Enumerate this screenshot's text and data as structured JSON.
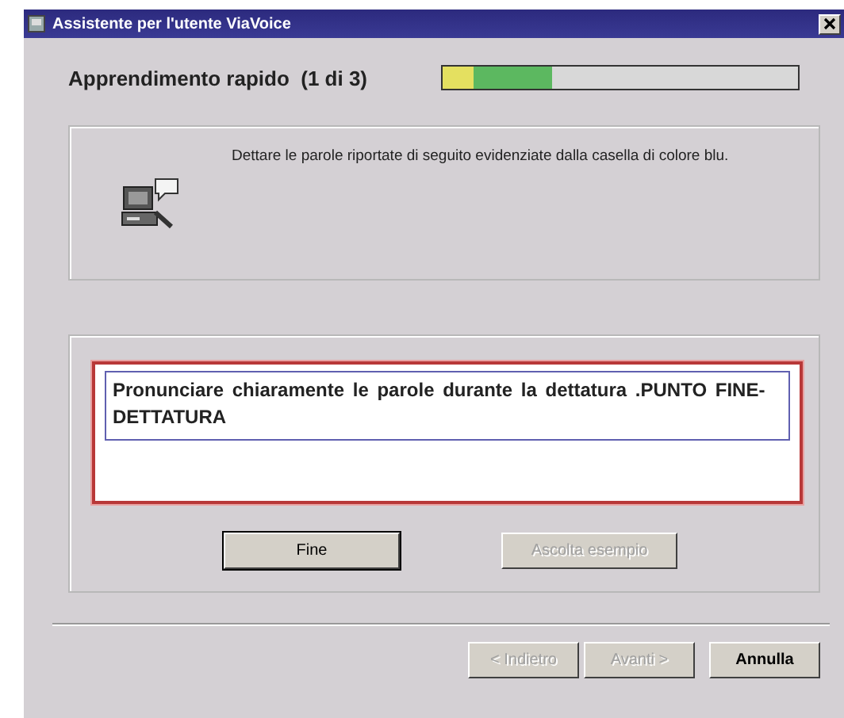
{
  "window": {
    "title": "Assistente per l'utente ViaVoice"
  },
  "header": {
    "title": "Apprendimento rapido  (1 di 3)",
    "progress": {
      "level": 0.31
    }
  },
  "instruction": "Dettare le parole riportate di seguito evidenziate dalla casella di colore blu.",
  "dictation": {
    "text": "Pronunciare chiaramente le parole durante la dettatura .PUNTO FINE-DETTATURA"
  },
  "panel_buttons": [
    {
      "label": "Fine",
      "disabled": false
    },
    {
      "label": "Ascolta esempio",
      "disabled": true
    }
  ],
  "nav_buttons": [
    {
      "label": "< Indietro",
      "disabled": true
    },
    {
      "label": "Avanti >",
      "disabled": true
    },
    {
      "label": "Annulla",
      "disabled": false
    }
  ]
}
